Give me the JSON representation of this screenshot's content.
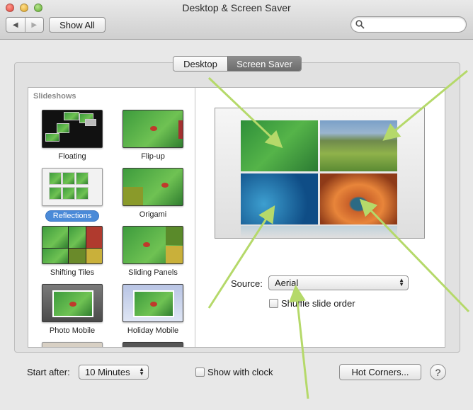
{
  "window": {
    "title": "Desktop & Screen Saver",
    "back_glyph": "◀",
    "forward_glyph": "▶",
    "show_all_label": "Show All",
    "search_placeholder": ""
  },
  "tabs": [
    {
      "label": "Desktop",
      "selected": false
    },
    {
      "label": "Screen Saver",
      "selected": true
    }
  ],
  "slideshows": {
    "header": "Slideshows",
    "items": [
      {
        "label": "Floating",
        "selected": false
      },
      {
        "label": "Flip-up",
        "selected": false
      },
      {
        "label": "Reflections",
        "selected": true
      },
      {
        "label": "Origami",
        "selected": false
      },
      {
        "label": "Shifting Tiles",
        "selected": false
      },
      {
        "label": "Sliding Panels",
        "selected": false
      },
      {
        "label": "Photo Mobile",
        "selected": false
      },
      {
        "label": "Holiday Mobile",
        "selected": false
      }
    ]
  },
  "source": {
    "label": "Source:",
    "value": "Aerial"
  },
  "shuffle": {
    "label": "Shuffle slide order",
    "checked": false
  },
  "start_after": {
    "label": "Start after:",
    "value": "10 Minutes"
  },
  "show_clock": {
    "label": "Show with clock",
    "checked": false
  },
  "hot_corners_label": "Hot Corners...",
  "help_glyph": "?",
  "colors": {
    "selection": "#4a8ad8",
    "annotation_arrow": "#b5d96a"
  }
}
